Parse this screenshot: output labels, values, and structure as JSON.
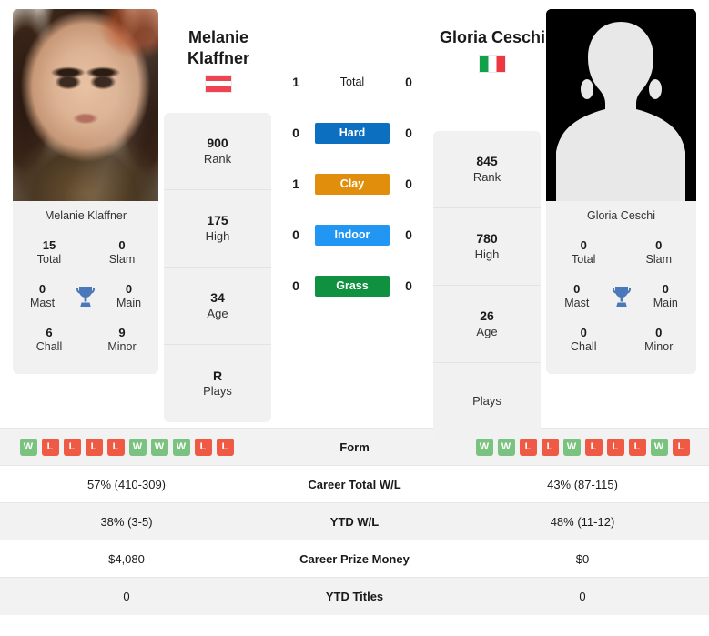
{
  "players": {
    "left": {
      "first_name": "Melanie",
      "last_name": "Klaffner",
      "full_name": "Melanie Klaffner",
      "flag": "austria-flag",
      "photo": "player-photo",
      "titles": {
        "total": "15",
        "total_label": "Total",
        "slam": "0",
        "slam_label": "Slam",
        "mast": "0",
        "mast_label": "Mast",
        "main": "0",
        "main_label": "Main",
        "chall": "6",
        "chall_label": "Chall",
        "minor": "9",
        "minor_label": "Minor"
      },
      "profile": [
        {
          "value": "900",
          "label": "Rank"
        },
        {
          "value": "175",
          "label": "High"
        },
        {
          "value": "34",
          "label": "Age"
        },
        {
          "value": "R",
          "label": "Plays"
        }
      ],
      "h2h": {
        "total": "1",
        "hard": "0",
        "clay": "1",
        "indoor": "0",
        "grass": "0"
      },
      "form": [
        "W",
        "L",
        "L",
        "L",
        "L",
        "W",
        "W",
        "W",
        "L",
        "L"
      ],
      "career_wl": "57% (410-309)",
      "ytd_wl": "38% (3-5)",
      "prize_money": "$4,080",
      "ytd_titles": "0"
    },
    "right": {
      "first_name": "Gloria",
      "last_name": "Ceschi",
      "full_name": "Gloria Ceschi",
      "flag": "italy-flag",
      "photo": "player-photo-placeholder",
      "titles": {
        "total": "0",
        "total_label": "Total",
        "slam": "0",
        "slam_label": "Slam",
        "mast": "0",
        "mast_label": "Mast",
        "main": "0",
        "main_label": "Main",
        "chall": "0",
        "chall_label": "Chall",
        "minor": "0",
        "minor_label": "Minor"
      },
      "profile": [
        {
          "value": "845",
          "label": "Rank"
        },
        {
          "value": "780",
          "label": "High"
        },
        {
          "value": "26",
          "label": "Age"
        },
        {
          "value": "",
          "label": "Plays"
        }
      ],
      "h2h": {
        "total": "0",
        "hard": "0",
        "clay": "0",
        "indoor": "0",
        "grass": "0"
      },
      "form": [
        "W",
        "W",
        "L",
        "L",
        "W",
        "L",
        "L",
        "L",
        "W",
        "L"
      ],
      "career_wl": "43% (87-115)",
      "ytd_wl": "48% (11-12)",
      "prize_money": "$0",
      "ytd_titles": "0"
    }
  },
  "h2h": {
    "total_label": "Total",
    "surfaces": [
      {
        "key": "hard",
        "label": "Hard",
        "color": "#0d6fc0"
      },
      {
        "key": "clay",
        "label": "Clay",
        "color": "#e08e0b"
      },
      {
        "key": "indoor",
        "label": "Indoor",
        "color": "#2196f3"
      },
      {
        "key": "grass",
        "label": "Grass",
        "color": "#109140"
      }
    ]
  },
  "table": {
    "rows": [
      {
        "label": "Form",
        "type": "form"
      },
      {
        "label": "Career Total W/L",
        "type": "text",
        "key": "career_wl"
      },
      {
        "label": "YTD W/L",
        "type": "text",
        "key": "ytd_wl"
      },
      {
        "label": "Career Prize Money",
        "type": "text",
        "key": "prize_money"
      },
      {
        "label": "YTD Titles",
        "type": "text",
        "key": "ytd_titles"
      }
    ]
  },
  "colors": {
    "win": "#7ac27f",
    "loss": "#ef5a45",
    "card_bg": "#f1f1f1",
    "row_shade": "#f2f2f2"
  }
}
